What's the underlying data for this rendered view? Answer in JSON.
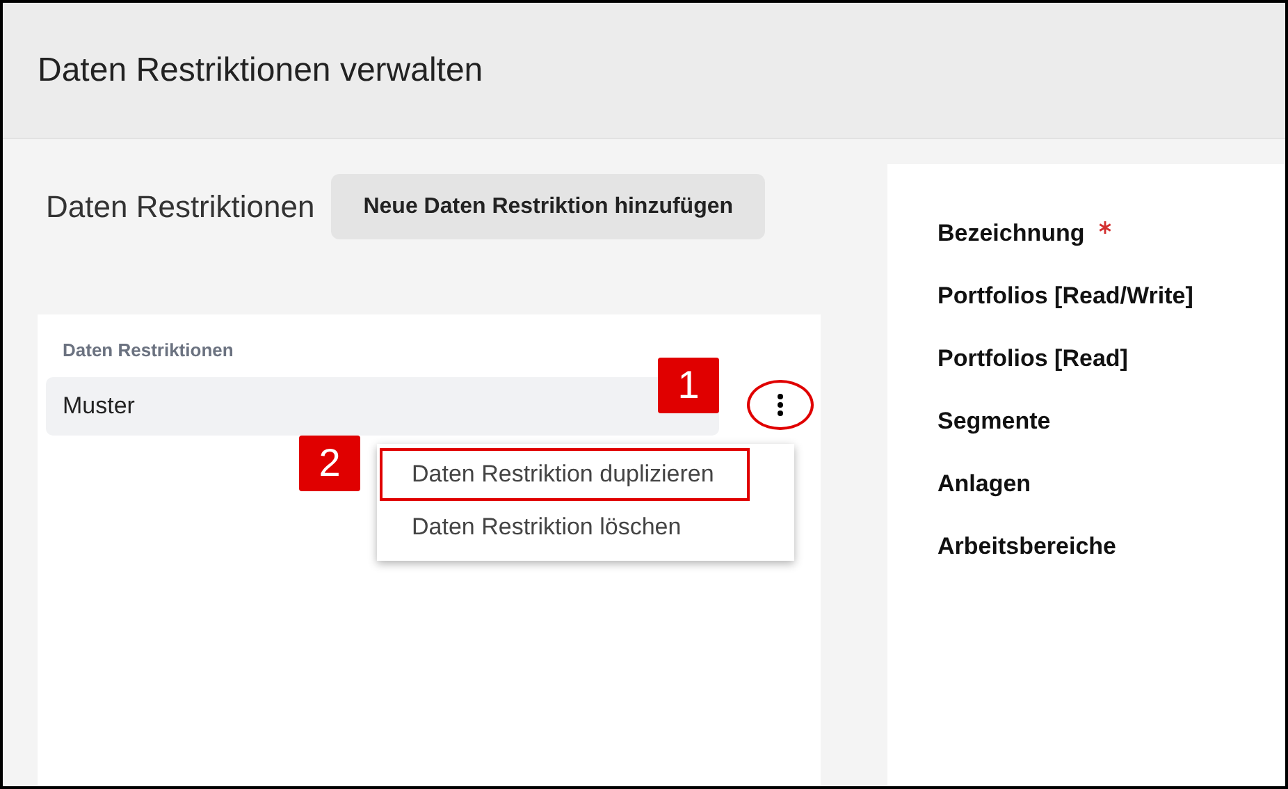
{
  "header": {
    "title": "Daten Restriktionen verwalten"
  },
  "toolbar": {
    "title": "Daten Restriktionen",
    "add_button": "Neue Daten Restriktion hinzufügen"
  },
  "list": {
    "heading": "Daten Restriktionen",
    "items": [
      {
        "label": "Muster",
        "callout": "1",
        "more_circled": true
      }
    ]
  },
  "context_menu": {
    "callout": "2",
    "items": [
      {
        "label": "Daten Restriktion duplizieren",
        "outlined": true
      },
      {
        "label": "Daten Restriktion löschen",
        "outlined": false
      }
    ]
  },
  "form": {
    "fields": [
      {
        "label": "Bezeichnung",
        "required": true
      },
      {
        "label": "Portfolios [Read/Write]",
        "required": false
      },
      {
        "label": "Portfolios [Read]",
        "required": false
      },
      {
        "label": "Segmente",
        "required": false
      },
      {
        "label": "Anlagen",
        "required": false
      },
      {
        "label": "Arbeitsbereiche",
        "required": false
      }
    ]
  }
}
